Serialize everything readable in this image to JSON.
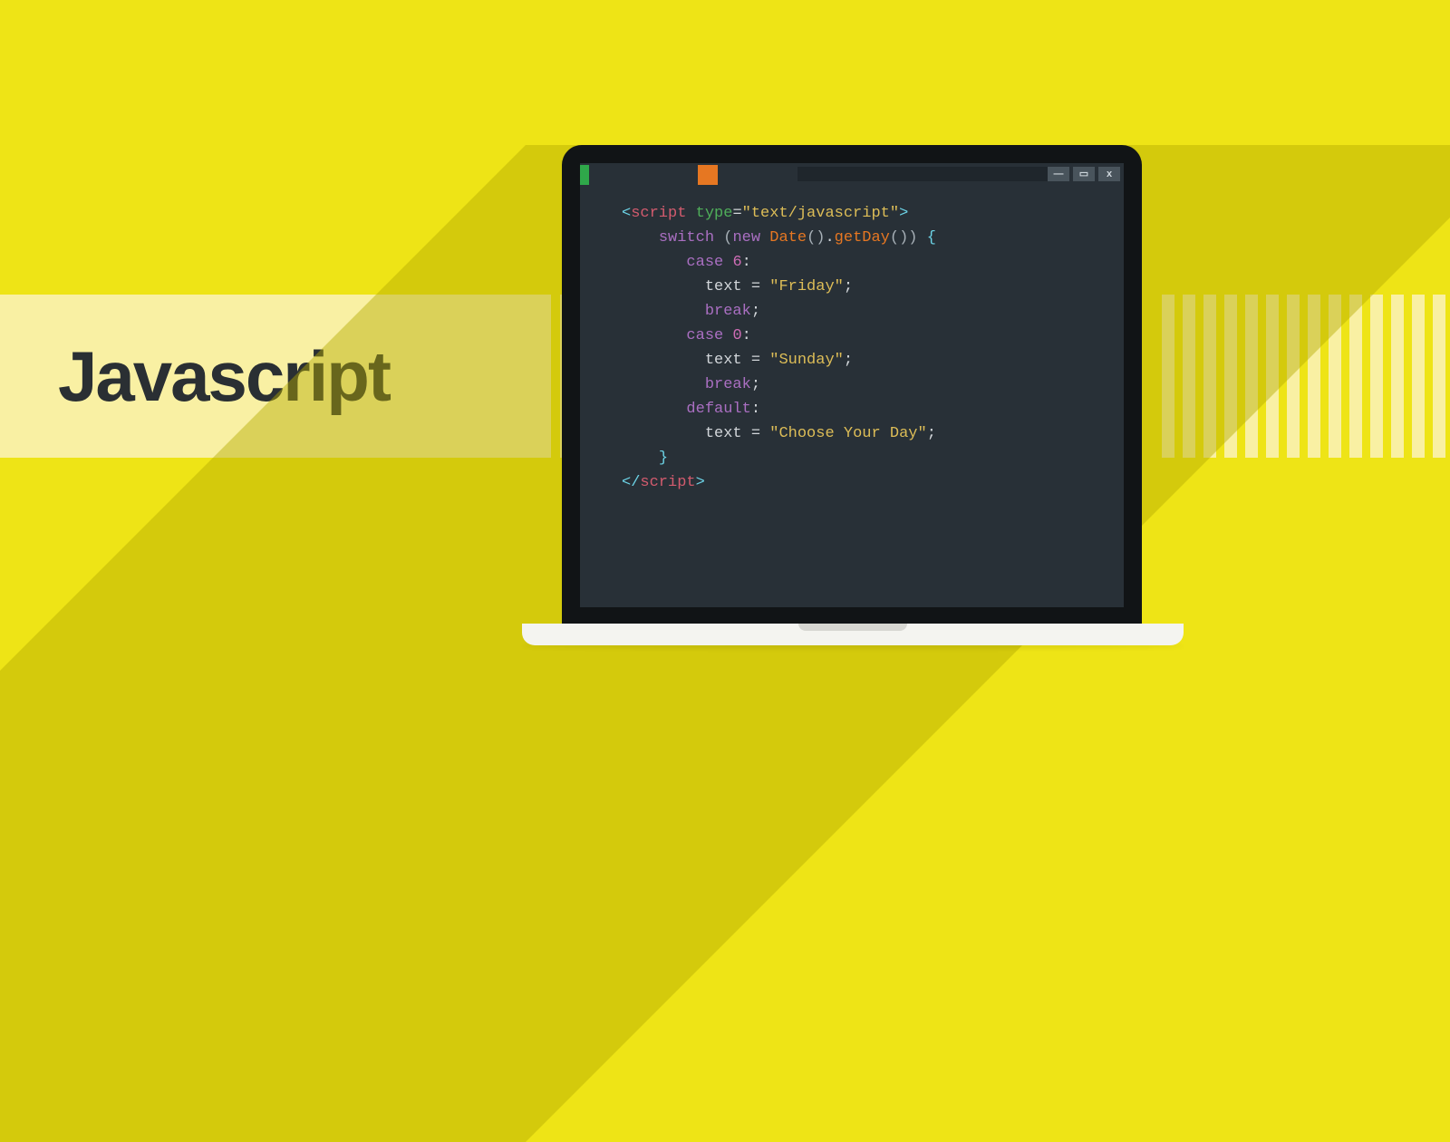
{
  "title": "Javascript",
  "window_buttons": {
    "minimize": "—",
    "maximize": "▭",
    "close": "x"
  },
  "code": {
    "line1": {
      "lt": "<",
      "tag": "script",
      "sp1": " ",
      "attr": "type",
      "eq": "=",
      "str": "\"text/javascript\"",
      "gt": ">"
    },
    "line2": {
      "kw_switch": "switch",
      "sp": " ",
      "lpar": "(",
      "kw_new": "new",
      "sp2": " ",
      "date": "Date",
      "paren1": "()",
      "dot": ".",
      "getday": "getDay",
      "paren2": "())",
      "sp3": " ",
      "lbrace": "{"
    },
    "line3": {
      "kw_case": "case",
      "sp": " ",
      "num": "6",
      "colon": ":"
    },
    "line4": {
      "var": "text",
      "sp": " ",
      "eq": "=",
      "sp2": " ",
      "str": "\"Friday\"",
      "semi": ";"
    },
    "line5": {
      "kw_break": "break",
      "semi": ";"
    },
    "line6": {
      "kw_case": "case",
      "sp": " ",
      "num": "0",
      "colon": ":"
    },
    "line7": {
      "var": "text",
      "sp": " ",
      "eq": "=",
      "sp2": " ",
      "str": "\"Sunday\"",
      "semi": ";"
    },
    "line8": {
      "kw_break": "break",
      "semi": ";"
    },
    "line9": {
      "kw_default": "default",
      "colon": ":"
    },
    "line10": {
      "var": "text",
      "sp": " ",
      "eq": "=",
      "sp2": " ",
      "str": "\"Choose Your Day\"",
      "semi": ";"
    },
    "line11": {
      "rbrace": "}"
    },
    "line12": {
      "lt": "<",
      "slash": "/",
      "tag": "script",
      "gt": ">"
    }
  }
}
